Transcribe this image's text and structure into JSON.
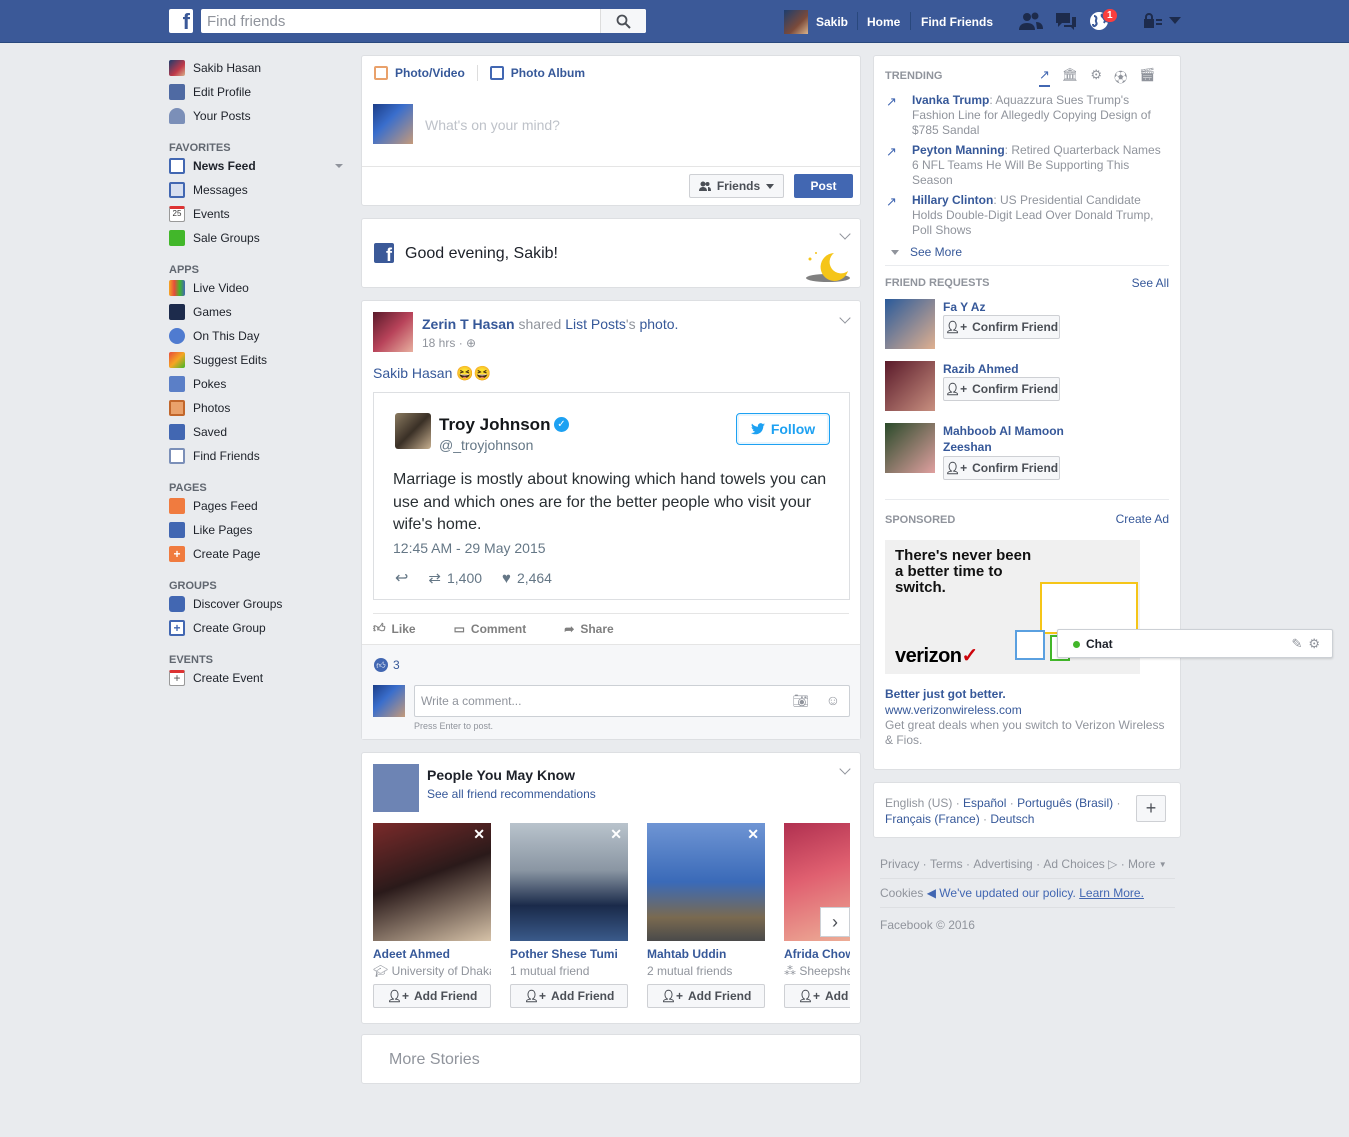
{
  "topbar": {
    "search_placeholder": "Find friends",
    "user_name": "Sakib",
    "home": "Home",
    "find_friends": "Find Friends",
    "notifications_count": "1"
  },
  "leftnav": {
    "profile": [
      {
        "label": "Sakib Hasan",
        "icon": "avatar"
      },
      {
        "label": "Edit Profile",
        "icon": "pencil-icon"
      },
      {
        "label": "Your Posts",
        "icon": "person-icon"
      }
    ],
    "favorites_head": "FAVORITES",
    "favorites": [
      {
        "label": "News Feed",
        "icon": "news-feed-icon"
      },
      {
        "label": "Messages",
        "icon": "messages-icon"
      },
      {
        "label": "Events",
        "icon": "calendar-icon",
        "glyph": "25"
      },
      {
        "label": "Sale Groups",
        "icon": "tag-icon"
      }
    ],
    "apps_head": "APPS",
    "apps": [
      {
        "label": "Live Video",
        "icon": "live-video-icon"
      },
      {
        "label": "Games",
        "icon": "games-icon"
      },
      {
        "label": "On This Day",
        "icon": "clock-icon"
      },
      {
        "label": "Suggest Edits",
        "icon": "checkmark-icon"
      },
      {
        "label": "Pokes",
        "icon": "poke-icon"
      },
      {
        "label": "Photos",
        "icon": "photos-icon"
      },
      {
        "label": "Saved",
        "icon": "bookmark-icon"
      },
      {
        "label": "Find Friends",
        "icon": "find-friends-icon"
      }
    ],
    "pages_head": "PAGES",
    "pages": [
      {
        "label": "Pages Feed",
        "icon": "flag-icon"
      },
      {
        "label": "Like Pages",
        "icon": "thumbs-up-icon"
      },
      {
        "label": "Create Page",
        "icon": "plus-icon"
      }
    ],
    "groups_head": "GROUPS",
    "groups": [
      {
        "label": "Discover Groups",
        "icon": "compass-icon"
      },
      {
        "label": "Create Group",
        "icon": "plus-icon"
      }
    ],
    "events_head": "EVENTS",
    "events": [
      {
        "label": "Create Event",
        "icon": "calendar-plus-icon"
      }
    ]
  },
  "composer": {
    "tab_photo": "Photo/Video",
    "tab_album": "Photo Album",
    "placeholder": "What's on your mind?",
    "audience": "Friends",
    "post": "Post"
  },
  "greeting": {
    "text": "Good evening, Sakib!"
  },
  "post": {
    "author": "Zerin T Hasan",
    "shared": "shared",
    "source": "List Posts",
    "possessive": "'s",
    "object": "photo.",
    "time": "18 hrs",
    "message": "Sakib Hasan 😆😆",
    "tweet": {
      "name": "Troy Johnson",
      "handle": "@_troyjohnson",
      "follow": "Follow",
      "text": "Marriage is mostly about knowing which hand towels you can use and which ones are for the better people who visit your wife's home.",
      "date": "12:45 AM - 29 May 2015",
      "retweets": "1,400",
      "likes": "2,464"
    },
    "actions": {
      "like": "Like",
      "comment": "Comment",
      "share": "Share"
    },
    "like_count": "3",
    "comment_placeholder": "Write a comment...",
    "press_enter": "Press Enter to post."
  },
  "pymk": {
    "title": "People You May Know",
    "see_all": "See all friend recommendations",
    "add_friend": "Add Friend",
    "people": [
      {
        "name": "Adeet Ahmed",
        "meta": "University of Dhaka",
        "meta_icon": "school-icon",
        "c1": "#7a2a2a",
        "c2": "#d6c2a8"
      },
      {
        "name": "Pother Shese Tumi",
        "meta": "1 mutual friend",
        "meta_icon": "",
        "c1": "#9aa6b2",
        "c2": "#1a2a4a"
      },
      {
        "name": "Mahtab Uddin",
        "meta": "2 mutual friends",
        "meta_icon": "",
        "c1": "#3a6ab8",
        "c2": "#4a4a4a"
      },
      {
        "name": "Afrida Chowdhury",
        "meta": "Sheepshead",
        "meta_icon": "network-icon",
        "c1": "#b03050",
        "c2": "#f0c0a0"
      }
    ]
  },
  "more_stories": "More Stories",
  "trending": {
    "head": "TRENDING",
    "items": [
      {
        "name": "Ivanka Trump",
        "text": ": Aquazzura Sues Trump's Fashion Line for Allegedly Copying Design of $785 Sandal"
      },
      {
        "name": "Peyton Manning",
        "text": ": Retired Quarterback Names 6 NFL Teams He Will Be Supporting This Season"
      },
      {
        "name": "Hillary Clinton",
        "text": ": US Presidential Candidate Holds Double-Digit Lead Over Donald Trump, Poll Shows"
      }
    ],
    "see_more": "See More"
  },
  "requests": {
    "head": "FRIEND REQUESTS",
    "see_all": "See All",
    "confirm": "Confirm Friend",
    "people": [
      {
        "name": "Fa Y Az",
        "c1": "#2a5a9a",
        "c2": "#e0b090"
      },
      {
        "name": "Razib Ahmed",
        "c1": "#5a1a2a",
        "c2": "#c89080"
      },
      {
        "name": "Mahboob Al Mamoon Zeeshan",
        "c1": "#2a4a2a",
        "c2": "#e0a0a0"
      }
    ]
  },
  "sponsored": {
    "head": "SPONSORED",
    "create_ad": "Create Ad",
    "ad_headline": "There's never been a better time to switch.",
    "ad_brand": "verizon",
    "title": "Better just got better.",
    "url": "www.verizonwireless.com",
    "desc": "Get great deals when you switch to Verizon Wireless & Fios."
  },
  "languages": {
    "current": "English (US)",
    "others": [
      "Español",
      "Português (Brasil)",
      "Français (France)",
      "Deutsch"
    ]
  },
  "footer": {
    "links": [
      "Privacy",
      "Terms",
      "Advertising",
      "Ad Choices",
      "More"
    ],
    "cookies": "Cookies",
    "policy": "We've updated our policy.",
    "learn_more": "Learn More.",
    "copyright": "Facebook © 2016"
  },
  "chat": {
    "label": "Chat"
  },
  "colors": {
    "brand": "#3b5998",
    "link": "#365899",
    "button": "#4267b2",
    "online": "#42b72a"
  }
}
